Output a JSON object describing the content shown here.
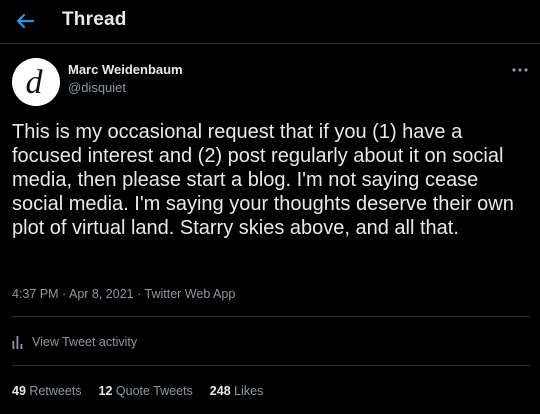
{
  "header": {
    "title": "Thread",
    "back_icon": "arrow-left-icon",
    "accent": "#1d9bf0"
  },
  "author": {
    "name": "Marc Weidenbaum",
    "handle": "@disquiet",
    "avatar_letter": "d"
  },
  "tweet": {
    "text": "This is my occasional request that if you (1) have a focused interest and (2) post regularly about it on social media, then please start a blog. I'm not saying cease social media. I'm saying your thoughts deserve their own plot of virtual land. Starry skies above, and all that.",
    "time": "4:37 PM",
    "sep1": " · ",
    "date": "Apr 8, 2021",
    "sep2": " · ",
    "source": "Twitter Web App"
  },
  "activity": {
    "label": "View Tweet activity",
    "icon": "bar-chart-icon"
  },
  "stats": {
    "retweets_count": "49",
    "retweets_label": "Retweets",
    "quotes_count": "12",
    "quotes_label": "Quote Tweets",
    "likes_count": "248",
    "likes_label": "Likes"
  },
  "more_icon": "more-horizontal-icon"
}
